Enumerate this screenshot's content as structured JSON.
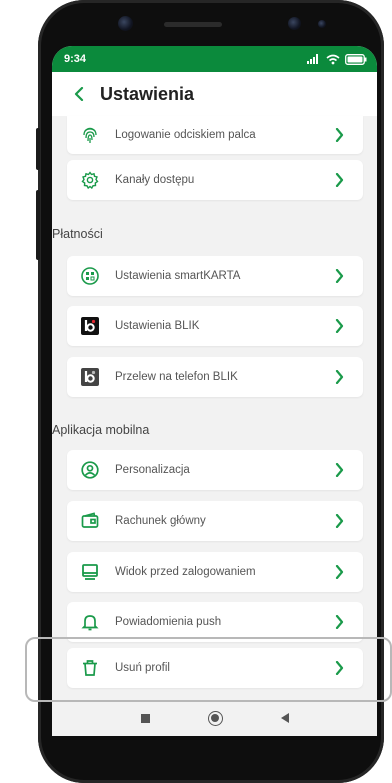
{
  "status_bar": {
    "time": "9:34"
  },
  "header": {
    "title": "Ustawienia",
    "back_icon": "chevron-left-icon"
  },
  "colors": {
    "brand_green": "#0b8a3c",
    "icon_green": "#1a9a4a",
    "chevron": "#1a9a4a"
  },
  "top_items": [
    {
      "label": "Logowanie odciskiem palca",
      "icon": "fingerprint-icon"
    },
    {
      "label": "Kanały dostępu",
      "icon": "gear-icon"
    }
  ],
  "sections": [
    {
      "title": "Płatności",
      "items": [
        {
          "label": "Ustawienia smartKARTA",
          "icon": "smartkarta-icon"
        },
        {
          "label": "Ustawienia BLIK",
          "icon": "blik-icon"
        },
        {
          "label": "Przelew na telefon BLIK",
          "icon": "blik-transfer-icon"
        }
      ]
    },
    {
      "title": "Aplikacja mobilna",
      "items": [
        {
          "label": "Personalizacja",
          "icon": "user-circle-icon"
        },
        {
          "label": "Rachunek główny",
          "icon": "wallet-icon"
        },
        {
          "label": "Widok przed zalogowaniem",
          "icon": "monitor-icon"
        },
        {
          "label": "Powiadomienia push",
          "icon": "bell-icon"
        },
        {
          "label": "Usuń profil",
          "icon": "trash-icon"
        }
      ]
    }
  ],
  "nav": {
    "recent": "square-icon",
    "home": "circle-icon",
    "back": "triangle-back-icon"
  }
}
